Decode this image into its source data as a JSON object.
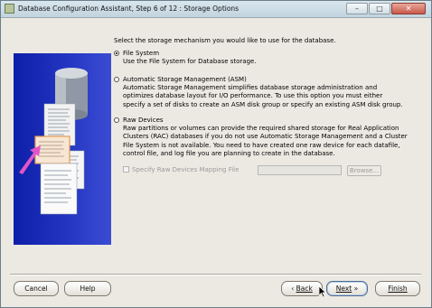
{
  "window": {
    "title": "Database Configuration Assistant, Step 6 of 12 : Storage Options",
    "controls": {
      "minimize": "–",
      "maximize": "□",
      "close": "✕"
    }
  },
  "intro": "Select the storage mechanism you would like to use for the database.",
  "options": [
    {
      "label": "File System",
      "selected": true,
      "description": [
        "Use the File System for Database storage."
      ]
    },
    {
      "label": "Automatic Storage Management (ASM)",
      "selected": false,
      "description": [
        "Automatic Storage Management simplifies database storage administration and",
        "optimizes database layout for I/O performance. To use this option you must either",
        "specify a set of disks to create an ASM disk group or specify an existing ASM disk group."
      ]
    },
    {
      "label": "Raw Devices",
      "selected": false,
      "description": [
        "Raw partitions or volumes can provide the required shared storage for Real Application",
        "Clusters (RAC) databases if you do not use Automatic Storage Management and a Cluster",
        "File System is not available.  You need to have created one raw device for each datafile,",
        "control file, and log file you are planning to create in the database."
      ]
    }
  ],
  "raw_mapping": {
    "label": "Specify Raw Devices Mapping File",
    "checked": false,
    "value": "",
    "browse_label": "Browse..."
  },
  "buttons": {
    "cancel": "Cancel",
    "help": "Help",
    "back": "Back",
    "next": "Next",
    "finish": "Finish"
  }
}
